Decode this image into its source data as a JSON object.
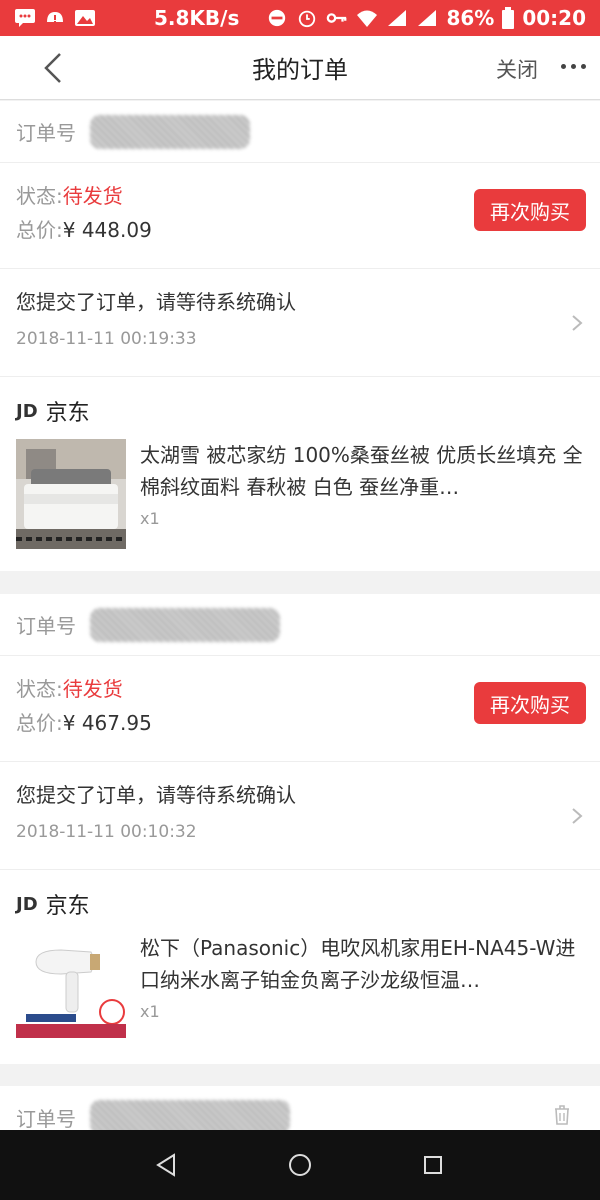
{
  "statusbar": {
    "speed": "5.8KB/s",
    "battery": "86%",
    "time": "00:20"
  },
  "header": {
    "title": "我的订单",
    "close_label": "关闭"
  },
  "labels": {
    "status": "状态:",
    "total": "总价:",
    "rebuy": "再次购买",
    "order_no": "订单号"
  },
  "orders": [
    {
      "status": "待发货",
      "total": "¥ 448.09",
      "track_msg": "您提交了订单，请等待系统确认",
      "track_time": "2018-11-11 00:19:33",
      "shop": "京东",
      "product": "太湖雪 被芯家纺 100%桑蚕丝被 优质长丝填充 全棉斜纹面料 春秋被 白色 蚕丝净重…",
      "qty": "x1"
    },
    {
      "status": "待发货",
      "total": "¥ 467.95",
      "track_msg": "您提交了订单，请等待系统确认",
      "track_time": "2018-11-11 00:10:32",
      "shop": "京东",
      "product": "松下（Panasonic）电吹风机家用EH-NA45-W进口纳米水离子铂金负离子沙龙级恒温…",
      "qty": "x1"
    }
  ],
  "jd_logo": "JD",
  "colors": {
    "accent": "#e93b3d"
  }
}
